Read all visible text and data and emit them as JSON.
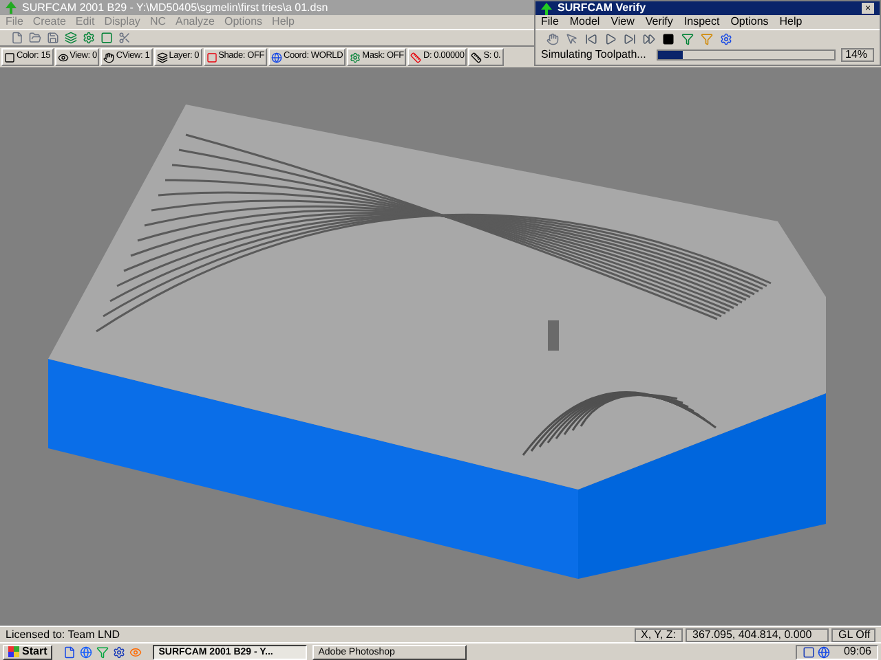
{
  "main_window": {
    "title": "SURFCAM 2001 B29 - Y:\\MD50405\\sgmelin\\first tries\\a 01.dsn",
    "menu": [
      "File",
      "Create",
      "Edit",
      "Display",
      "NC",
      "Analyze",
      "Options",
      "Help"
    ],
    "settings": [
      {
        "label": "Color: 15"
      },
      {
        "label": "View: 0"
      },
      {
        "label": "CView: 1"
      },
      {
        "label": "Layer: 0"
      },
      {
        "label": "Shade: OFF"
      },
      {
        "label": "Coord: WORLD"
      },
      {
        "label": "Mask: OFF"
      },
      {
        "label": "D: 0.00000"
      },
      {
        "label": "S: 0."
      }
    ]
  },
  "verify_window": {
    "title": "SURFCAM Verify",
    "close": "×",
    "menu": [
      "File",
      "Model",
      "View",
      "Verify",
      "Inspect",
      "Options",
      "Help"
    ],
    "progress": {
      "status": "Simulating Toolpath...",
      "level": 0.14,
      "percent": "14%"
    }
  },
  "status_bar": {
    "license": "Licensed to: Team LND",
    "coord_label": "X, Y, Z:",
    "coords": "367.095, 404.814, 0.000",
    "gl": "GL Off"
  },
  "taskbar": {
    "start": "Start",
    "tasks": [
      {
        "label": "SURFCAM 2001 B29 - Y...",
        "selected": true
      },
      {
        "label": "Adobe Photoshop",
        "selected": false
      }
    ],
    "clock": "09:06"
  }
}
